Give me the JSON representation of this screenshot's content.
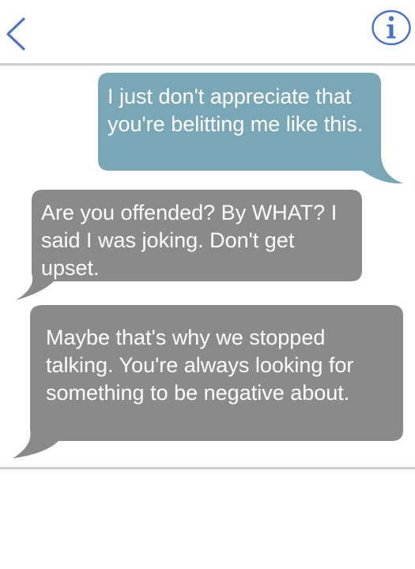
{
  "header": {
    "back_icon": "chevron-left-icon",
    "info_icon": "info-circle-icon",
    "accent_color": "#4a72c4"
  },
  "messages": [
    {
      "direction": "sent",
      "text": "I just don't appreciate that you're belitting me like this.",
      "color": "#7aa7b6"
    },
    {
      "direction": "received",
      "text": "Are you offended? By WHAT? I said I was joking. Don't get upset.",
      "color": "#8a8a8a"
    },
    {
      "direction": "received",
      "text": "Maybe that's why we stopped talking. You're always looking for something to be negative about.",
      "color": "#8a8a8a"
    }
  ]
}
